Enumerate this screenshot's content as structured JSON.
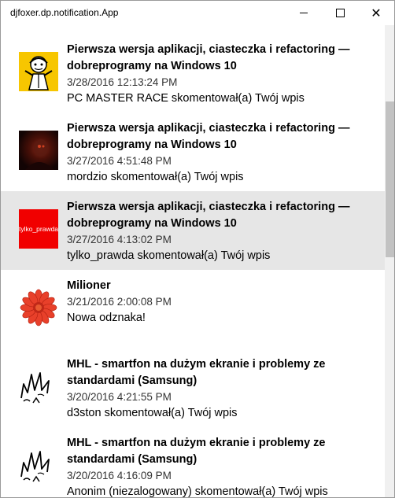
{
  "window": {
    "title": "djfoxer.dp.notification.App"
  },
  "notifications": [
    {
      "title": "Pierwsza wersja aplikacji, ciasteczka i refactoring — dobreprogramy na Windows 10",
      "date": "3/28/2016 12:13:24 PM",
      "message": "PC MASTER RACE skomentował(a) Twój wpis",
      "avatar": "pc-master-race-avatar"
    },
    {
      "title": "Pierwsza wersja aplikacji, ciasteczka i refactoring — dobreprogramy na Windows 10",
      "date": "3/27/2016 4:51:48 PM",
      "message": "mordzio skomentował(a) Twój wpis",
      "avatar": "mordzio-avatar"
    },
    {
      "title": "Pierwsza wersja aplikacji, ciasteczka i refactoring — dobreprogramy na Windows 10",
      "date": "3/27/2016 4:13:02 PM",
      "message": "tylko_prawda skomentował(a) Twój wpis",
      "avatar_text": "tylko_prawda",
      "selected": true
    },
    {
      "title": "Milioner",
      "date": "3/21/2016 2:00:08 PM",
      "message": "Nowa odznaka!",
      "avatar": "flower-badge-icon"
    },
    {
      "title": "MHL - smartfon na dużym ekranie i problemy ze standardami (Samsung)",
      "date": "3/20/2016 4:21:55 PM",
      "message": "d3ston skomentował(a) Twój wpis",
      "avatar": "sketch-avatar"
    },
    {
      "title": "MHL - smartfon na dużym ekranie i problemy ze standardami (Samsung)",
      "date": "3/20/2016 4:16:09 PM",
      "message": "Anonim (niezalogowany) skomentował(a) Twój wpis",
      "avatar": "sketch-avatar"
    }
  ],
  "colors": {
    "selected_row": "#e6e6e6",
    "pcmr_yellow": "#f7c600",
    "tylko_red": "#f10000",
    "flower_red": "#e8402a"
  }
}
